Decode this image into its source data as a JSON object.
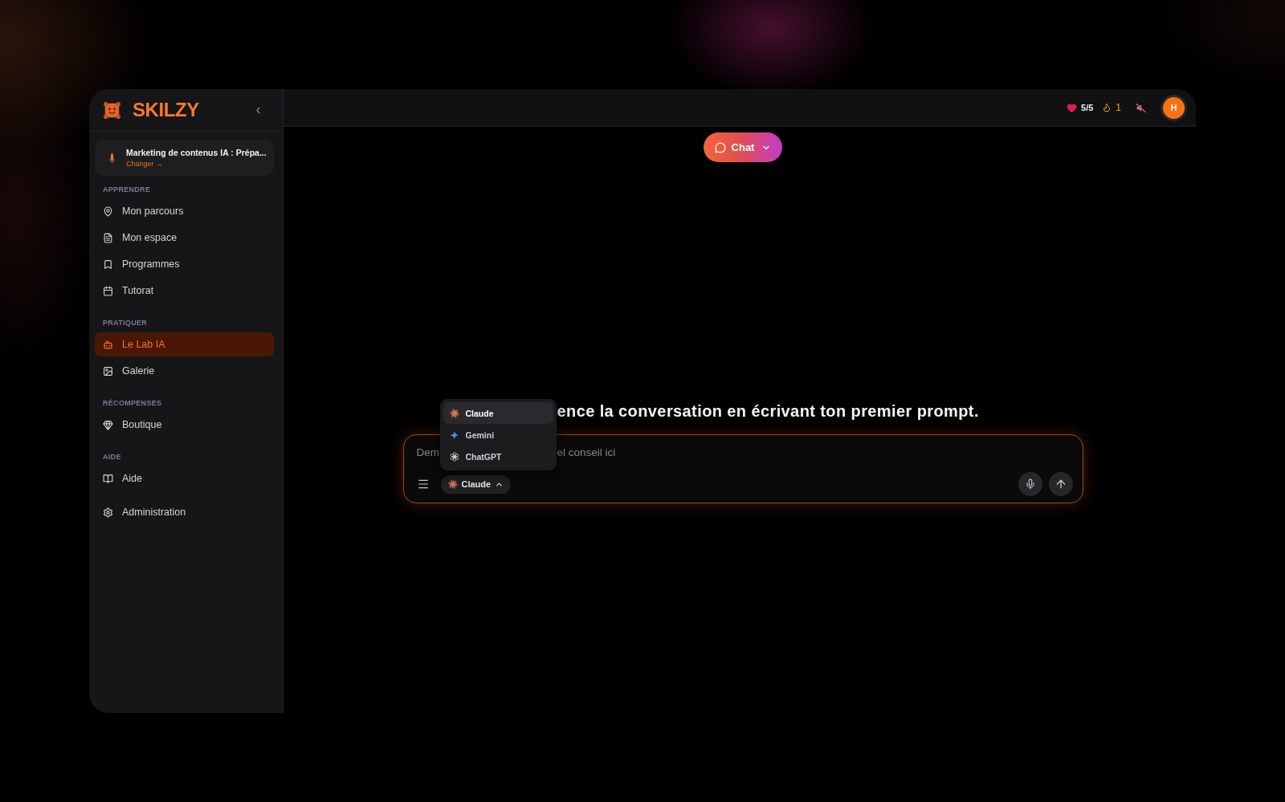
{
  "sidebar": {
    "brand": "SKILZY",
    "course": {
      "title": "Marketing de contenus IA : Prépa...",
      "action": "Changer →"
    },
    "sections": [
      {
        "title": "APPRENDRE",
        "items": [
          {
            "label": "Mon parcours",
            "selected": false
          },
          {
            "label": "Mon espace",
            "selected": false
          },
          {
            "label": "Programmes",
            "selected": false
          },
          {
            "label": "Tutorat",
            "selected": false
          }
        ]
      },
      {
        "title": "PRATIQUER",
        "items": [
          {
            "label": "Le Lab IA",
            "selected": true
          },
          {
            "label": "Galerie",
            "selected": false
          }
        ]
      },
      {
        "title": "RÉCOMPENSES",
        "items": [
          {
            "label": "Boutique",
            "selected": false
          }
        ]
      },
      {
        "title": "AIDE",
        "items": [
          {
            "label": "Aide",
            "selected": false
          }
        ]
      },
      {
        "items": [
          {
            "label": "Administration",
            "selected": false
          }
        ]
      }
    ]
  },
  "topbar": {
    "lives": "5/5",
    "streak": "1",
    "muted": true,
    "avatar": "H"
  },
  "mode_button": {
    "label": "Chat"
  },
  "heading": "ence la conversation en écrivant ton premier prompt.",
  "composer": {
    "placeholder_fragments": [
      "Dem",
      "el conseil ici"
    ],
    "model": "Claude",
    "model_menu": {
      "open": true,
      "items": [
        {
          "label": "Claude",
          "selected": true
        },
        {
          "label": "Gemini",
          "selected": false
        },
        {
          "label": "ChatGPT",
          "selected": false
        }
      ]
    }
  }
}
